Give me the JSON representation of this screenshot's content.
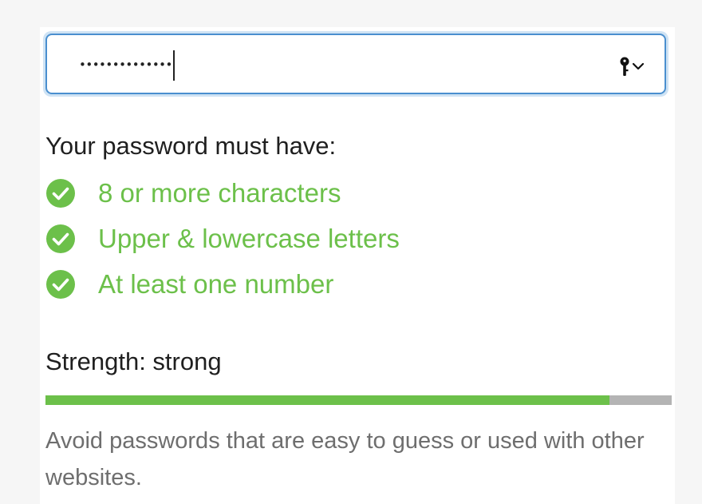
{
  "password_field": {
    "masked_value": "••••••••••••••",
    "key_icon": "key-icon",
    "dropdown_icon": "chevron-down-icon"
  },
  "requirements": {
    "title": "Your password must have:",
    "items": [
      {
        "label": "8 or more characters",
        "met": true,
        "icon": "check-circle-icon"
      },
      {
        "label": "Upper & lowercase letters",
        "met": true,
        "icon": "check-circle-icon"
      },
      {
        "label": "At least one number",
        "met": true,
        "icon": "check-circle-icon"
      }
    ]
  },
  "strength": {
    "label": "Strength: strong",
    "level_fraction": 0.9
  },
  "hint": "Avoid passwords that are easy to guess or used with other websites.",
  "colors": {
    "success_green": "#6cc04a",
    "focus_blue": "#4a8fcf",
    "meter_track": "#b4b4b4"
  }
}
